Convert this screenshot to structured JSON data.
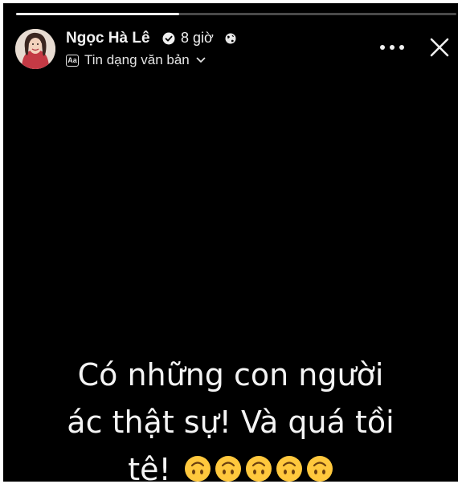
{
  "story": {
    "progress_fraction": 0.37,
    "author": "Ngọc Hà Lê",
    "verified": true,
    "time": "8 giờ",
    "audience_icon": "globe-icon",
    "type_label": "Tin dạng văn bản",
    "type_icon_text": "Aa",
    "line1": "Có những con người",
    "line2": "ác thật sự! Và quá tồi",
    "line3": "tệ!",
    "emoji_name": "upside-down-face",
    "emoji_count": 5
  },
  "colors": {
    "background": "#000000",
    "text": "#f4f4f4",
    "emoji_yellow": "#ffc83d",
    "verified_badge": "#f0f0f0"
  }
}
